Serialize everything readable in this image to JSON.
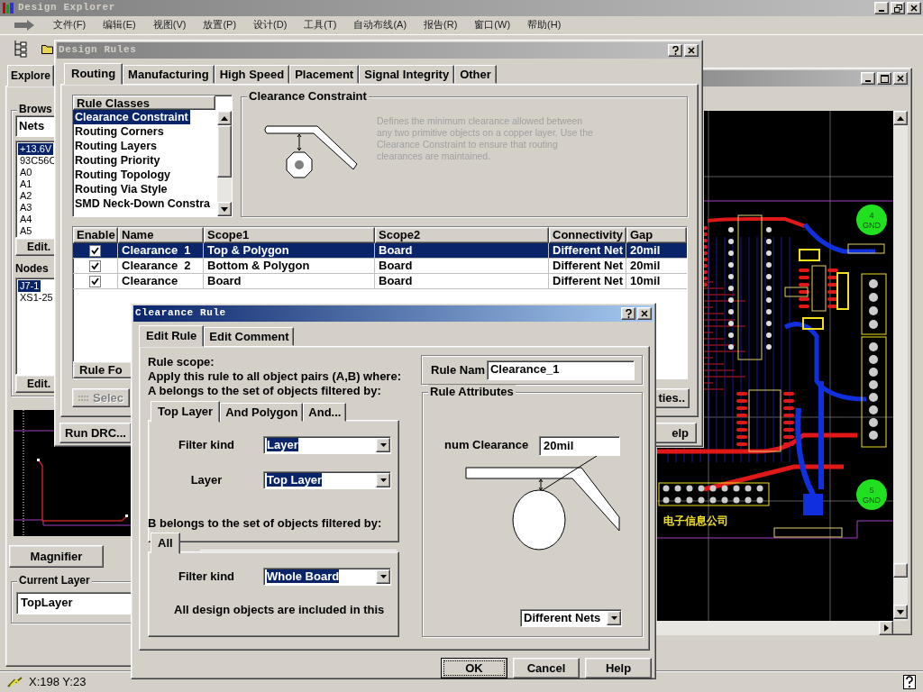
{
  "app": {
    "title": "Design Explorer",
    "menu": [
      "文件(F)",
      "编辑(E)",
      "视图(V)",
      "放置(P)",
      "设计(D)",
      "工具(T)",
      "自动布线(A)",
      "报告(R)",
      "窗口(W)",
      "帮助(H)"
    ]
  },
  "explorer": {
    "tab": "Explore",
    "browse_label": "Brows",
    "browse_type": {
      "value": "Nets",
      "highlighted": false
    },
    "nets": [
      {
        "label": "+13.6V",
        "selected": true
      },
      {
        "label": "93C56C",
        "selected": false
      },
      {
        "label": "A0",
        "selected": false
      },
      {
        "label": "A1",
        "selected": false
      },
      {
        "label": "A2",
        "selected": false
      },
      {
        "label": "A3",
        "selected": false
      },
      {
        "label": "A4",
        "selected": false
      },
      {
        "label": "A5",
        "selected": false
      }
    ],
    "nets_edit": "Edit.",
    "nodes_label": "Nodes",
    "nodes": [
      {
        "label": "J7-1",
        "selected": true
      },
      {
        "label": "XS1-25",
        "selected": false
      }
    ],
    "nodes_edit": "Edit.",
    "magnifier": "Magnifier",
    "current_layer_label": "Current Layer",
    "current_layer": "TopLayer"
  },
  "pcb": {
    "pads": [
      {
        "number": "4",
        "net": "GND"
      },
      {
        "number": "5",
        "net": "GND"
      }
    ],
    "silkscreen": "电子信息公司"
  },
  "design_rules": {
    "title": "Design Rules",
    "tabs": [
      {
        "label": "Routing",
        "selected": true
      },
      {
        "label": "Manufacturing",
        "selected": false
      },
      {
        "label": "High Speed",
        "selected": false
      },
      {
        "label": "Placement",
        "selected": false
      },
      {
        "label": "Signal Integrity",
        "selected": false
      },
      {
        "label": "Other",
        "selected": false
      }
    ],
    "rule_classes": {
      "header": "Rule Classes",
      "items": [
        {
          "label": "Clearance Constraint",
          "selected": true
        },
        {
          "label": "Routing Corners",
          "selected": false
        },
        {
          "label": "Routing Layers",
          "selected": false
        },
        {
          "label": "Routing Priority",
          "selected": false
        },
        {
          "label": "Routing Topology",
          "selected": false
        },
        {
          "label": "Routing Via Style",
          "selected": false
        },
        {
          "label": "SMD Neck-Down Constra",
          "selected": false
        }
      ]
    },
    "constraint": {
      "title": "Clearance Constraint",
      "description": "Defines the minimum clearance allowed between any two primitive objects on a copper layer. Use the Clearance Constraint to ensure that routing clearances are maintained."
    },
    "table": {
      "columns": [
        "Enable",
        "Name",
        "Scope1",
        "Scope2",
        "Connectivity",
        "Gap"
      ],
      "rows": [
        {
          "enabled": true,
          "name": "Clearance  1",
          "scope1": "Top & Polygon",
          "scope2": "Board",
          "connectivity": "Different Net",
          "gap": "20mil",
          "selected": true
        },
        {
          "enabled": true,
          "name": "Clearance  2",
          "scope1": "Bottom & Polygon",
          "scope2": "Board",
          "connectivity": "Different Net",
          "gap": "20mil",
          "selected": false
        },
        {
          "enabled": true,
          "name": "Clearance",
          "scope1": "Board",
          "scope2": "Board",
          "connectivity": "Different Net",
          "gap": "10mil",
          "selected": false
        }
      ]
    },
    "rule_fo": "Rule Fo",
    "select": {
      "label": "Selec",
      "disabled": true
    },
    "run_drc": "Run DRC...",
    "properties": "ties..",
    "help": "elp"
  },
  "clearance_rule": {
    "title": "Clearance Rule",
    "tabs": [
      {
        "label": "Edit Rule",
        "selected": true
      },
      {
        "label": "Edit Comment",
        "selected": false
      }
    ],
    "scope_lines": [
      "Rule scope:",
      "Apply this rule to all object pairs (A,B) where:",
      "A belongs to the set of objects filtered by:"
    ],
    "a_filter": {
      "tabs": [
        {
          "label": "Top Layer",
          "selected": true
        },
        {
          "label": "And Polygon",
          "selected": false
        },
        {
          "label": "And...",
          "selected": false
        }
      ],
      "fields": [
        {
          "label": "Filter kind",
          "value": "Layer",
          "highlighted": true
        },
        {
          "label": "Layer",
          "value": "Top Layer",
          "highlighted": true
        }
      ]
    },
    "b_heading": "B belongs to the set of objects filtered by:",
    "b_filter": {
      "tabs": [
        {
          "label": "All",
          "selected": true
        }
      ],
      "fields": [
        {
          "label": "Filter kind",
          "value": "Whole Board",
          "highlighted": true
        }
      ],
      "note": "All design objects are included in this"
    },
    "rule_name": {
      "label": "Rule Nam",
      "value": "Clearance_1"
    },
    "attributes": {
      "title": "Rule Attributes",
      "clearance_label": "num Clearance",
      "clearance_value": "20mil",
      "connectivity": {
        "value": "Different Nets",
        "highlighted": false
      }
    },
    "buttons": [
      {
        "label": "OK",
        "focused": true
      },
      {
        "label": "Cancel",
        "focused": false
      },
      {
        "label": "Help",
        "focused": false
      }
    ]
  },
  "status_bar": {
    "coords": "X:198 Y:23"
  }
}
